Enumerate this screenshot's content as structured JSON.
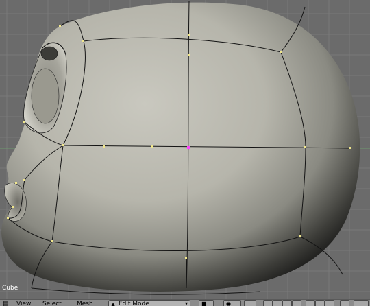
{
  "viewport": {
    "object_name": "Cube",
    "background_color": "#6b6b6b",
    "grid_color": "#7d7d7d",
    "horizon_line_color": "#5f8a5f",
    "mesh_color": "#c8c7bd",
    "edge_color": "#1a1a1a",
    "vertex_color": "#f0e68c"
  },
  "header": {
    "menu_view": "View",
    "menu_select": "Select",
    "menu_mesh": "Mesh",
    "mode_label": "Edit Mode",
    "mode_icon": "edit-mode-icon",
    "pivot_icon": "pivot-icon",
    "layer_icons": [
      "layer-1",
      "layer-2",
      "layer-3",
      "layer-4",
      "layer-5",
      "layer-6",
      "layer-7",
      "layer-8"
    ]
  }
}
